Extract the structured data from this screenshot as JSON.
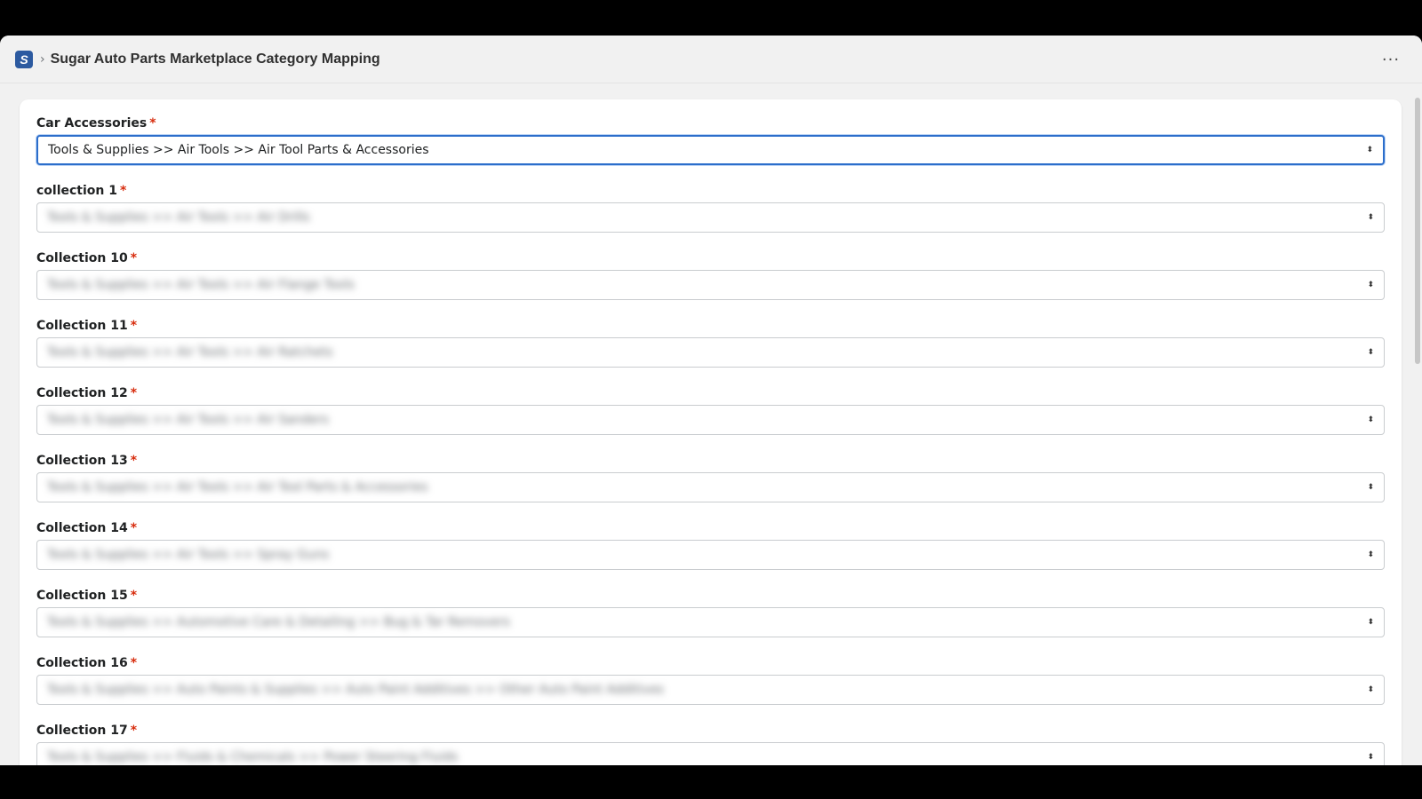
{
  "app": {
    "breadcrumb_separator": "›",
    "title": "Sugar Auto Parts Marketplace Category Mapping",
    "more_label": "···"
  },
  "fields": [
    {
      "label": "Car Accessories",
      "value": "Tools & Supplies >> Air Tools >> Air Tool Parts & Accessories",
      "blurred": false,
      "focused": true
    },
    {
      "label": "collection 1",
      "value": "Tools & Supplies >> Air Tools >> Air Drills",
      "blurred": true
    },
    {
      "label": "Collection 10",
      "value": "Tools & Supplies >> Air Tools >> Air Flange Tools",
      "blurred": true
    },
    {
      "label": "Collection 11",
      "value": "Tools & Supplies >> Air Tools >> Air Ratchets",
      "blurred": true
    },
    {
      "label": "Collection 12",
      "value": "Tools & Supplies >> Air Tools >> Air Sanders",
      "blurred": true
    },
    {
      "label": "Collection 13",
      "value": "Tools & Supplies >> Air Tools >> Air Tool Parts & Accessories",
      "blurred": true
    },
    {
      "label": "Collection 14",
      "value": "Tools & Supplies >> Air Tools >> Spray Guns",
      "blurred": true
    },
    {
      "label": "Collection 15",
      "value": "Tools & Supplies >> Automotive Care & Detailing >> Bug & Tar Removers",
      "blurred": true
    },
    {
      "label": "Collection 16",
      "value": "Tools & Supplies >> Auto Paints & Supplies >> Auto Paint Additives >> Other Auto Paint Additives",
      "blurred": true
    },
    {
      "label": "Collection 17",
      "value": "Tools & Supplies >> Fluids & Chemicals >> Power Steering Fluids",
      "blurred": true
    }
  ],
  "required_marker": "*",
  "caret_glyph": "⬍",
  "colors": {
    "logo": "#2c5aa0",
    "required": "#d72c0d",
    "focus_border": "#2c6ecb"
  }
}
